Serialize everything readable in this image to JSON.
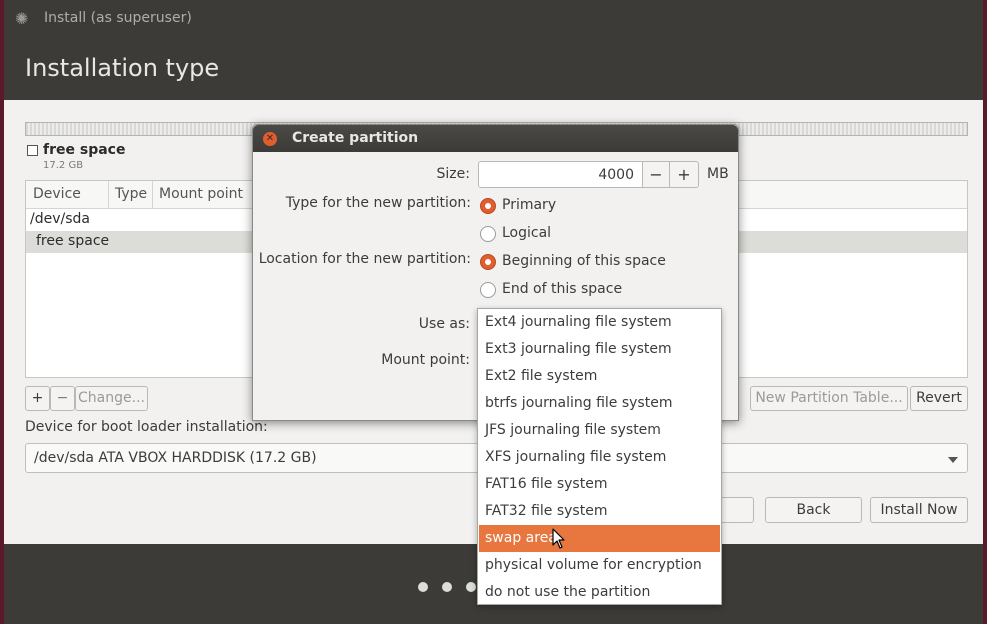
{
  "window": {
    "title": "Install (as superuser)",
    "heading": "Installation type"
  },
  "partitions": {
    "legend_label": "free space",
    "legend_size": "17.2 GB",
    "columns": [
      "Device",
      "Type",
      "Mount point"
    ],
    "rows": [
      {
        "device": "/dev/sda",
        "selected": false
      },
      {
        "device": "free space",
        "selected": true
      }
    ]
  },
  "controls": {
    "add": "+",
    "remove": "−",
    "change": "Change...",
    "new_table": "New Partition Table...",
    "revert": "Revert"
  },
  "bootloader": {
    "label": "Device for boot loader installation:",
    "value": "/dev/sda ATA VBOX HARDDISK (17.2 GB)"
  },
  "nav": {
    "back": "Back",
    "install_now": "Install Now"
  },
  "dialog": {
    "title": "Create partition",
    "size_label": "Size:",
    "size_value": "4000",
    "size_unit": "MB",
    "minus": "−",
    "plus": "+",
    "type_label": "Type for the new partition:",
    "type_options": [
      "Primary",
      "Logical"
    ],
    "type_selected": "Primary",
    "location_label": "Location for the new partition:",
    "location_options": [
      "Beginning of this space",
      "End of this space"
    ],
    "location_selected": "Beginning of this space",
    "use_as_label": "Use as:",
    "mount_label": "Mount point:",
    "use_as_options": [
      "Ext4 journaling file system",
      "Ext3 journaling file system",
      "Ext2 file system",
      "btrfs journaling file system",
      "JFS journaling file system",
      "XFS journaling file system",
      "FAT16 file system",
      "FAT32 file system",
      "swap area",
      "physical volume for encryption",
      "do not use the partition"
    ],
    "use_as_highlighted": "swap area"
  },
  "progress": {
    "total_steps": 7,
    "current_step": 6
  },
  "colors": {
    "accent": "#e05d2f",
    "highlight": "#e8763f",
    "titlebar": "#3c3b37"
  },
  "icons": {
    "app": "gear-icon",
    "close": "close-icon",
    "dropdown": "chevron-down-icon",
    "cursor": "mouse-pointer-icon"
  }
}
